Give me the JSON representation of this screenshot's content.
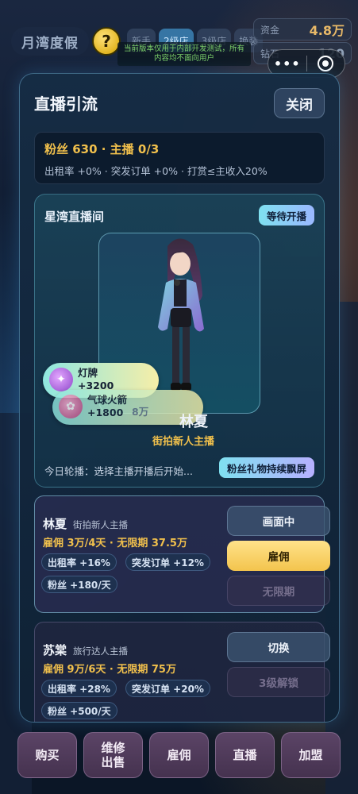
{
  "hud": {
    "title": "月湾度假",
    "help_label": "?",
    "tabs": [
      "新手",
      "2级店",
      "3级店",
      "换装"
    ],
    "funds_label": "资金",
    "funds_value": "4.8万",
    "diamond_label": "钻石",
    "diamond_value": "120",
    "dev_notice": "当前版本仅用于内部开发测试，所有内容均不面向用户"
  },
  "modal": {
    "title": "直播引流",
    "close_label": "关闭",
    "stats": {
      "line1": "粉丝 630 · 主播 0/3",
      "line2": "出租率 +0% · 突发订单 +0% · 打赏≤主收入20%"
    },
    "studio": {
      "name": "星湾直播间",
      "status": "等待开播",
      "host_name": "林夏",
      "host_title": "街拍新人主播",
      "rotation_text": "今日轮播：选择主播开播后开始...",
      "fans_badge": "粉丝礼物持续飘屏",
      "gifts": [
        {
          "name": "灯牌",
          "amount": "+3200"
        },
        {
          "name": "气球火箭",
          "amount": "+1800",
          "extra": "8万"
        }
      ]
    },
    "hosts": [
      {
        "name": "林夏",
        "title": "街拍新人主播",
        "price": "雇佣 3万/4天 · 无限期 37.5万",
        "chips": [
          "出租率 +16%",
          "突发订单 +12%",
          "粉丝 +180/天"
        ],
        "actions": [
          "画面中",
          "雇佣",
          "无限期"
        ]
      },
      {
        "name": "苏棠",
        "title": "旅行达人主播",
        "price": "雇佣 9万/6天 · 无限期 75万",
        "chips": [
          "出租率 +28%",
          "突发订单 +20%",
          "粉丝 +500/天"
        ],
        "actions": [
          "切换",
          "3级解锁"
        ]
      }
    ]
  },
  "bottom_nav": [
    "购买",
    "维修\n出售",
    "雇佣",
    "直播",
    "加盟"
  ],
  "colors": {
    "accent_gold": "#f1c04c",
    "accent_cyan": "#7fe0f0",
    "panel_bg": "#16304a"
  }
}
